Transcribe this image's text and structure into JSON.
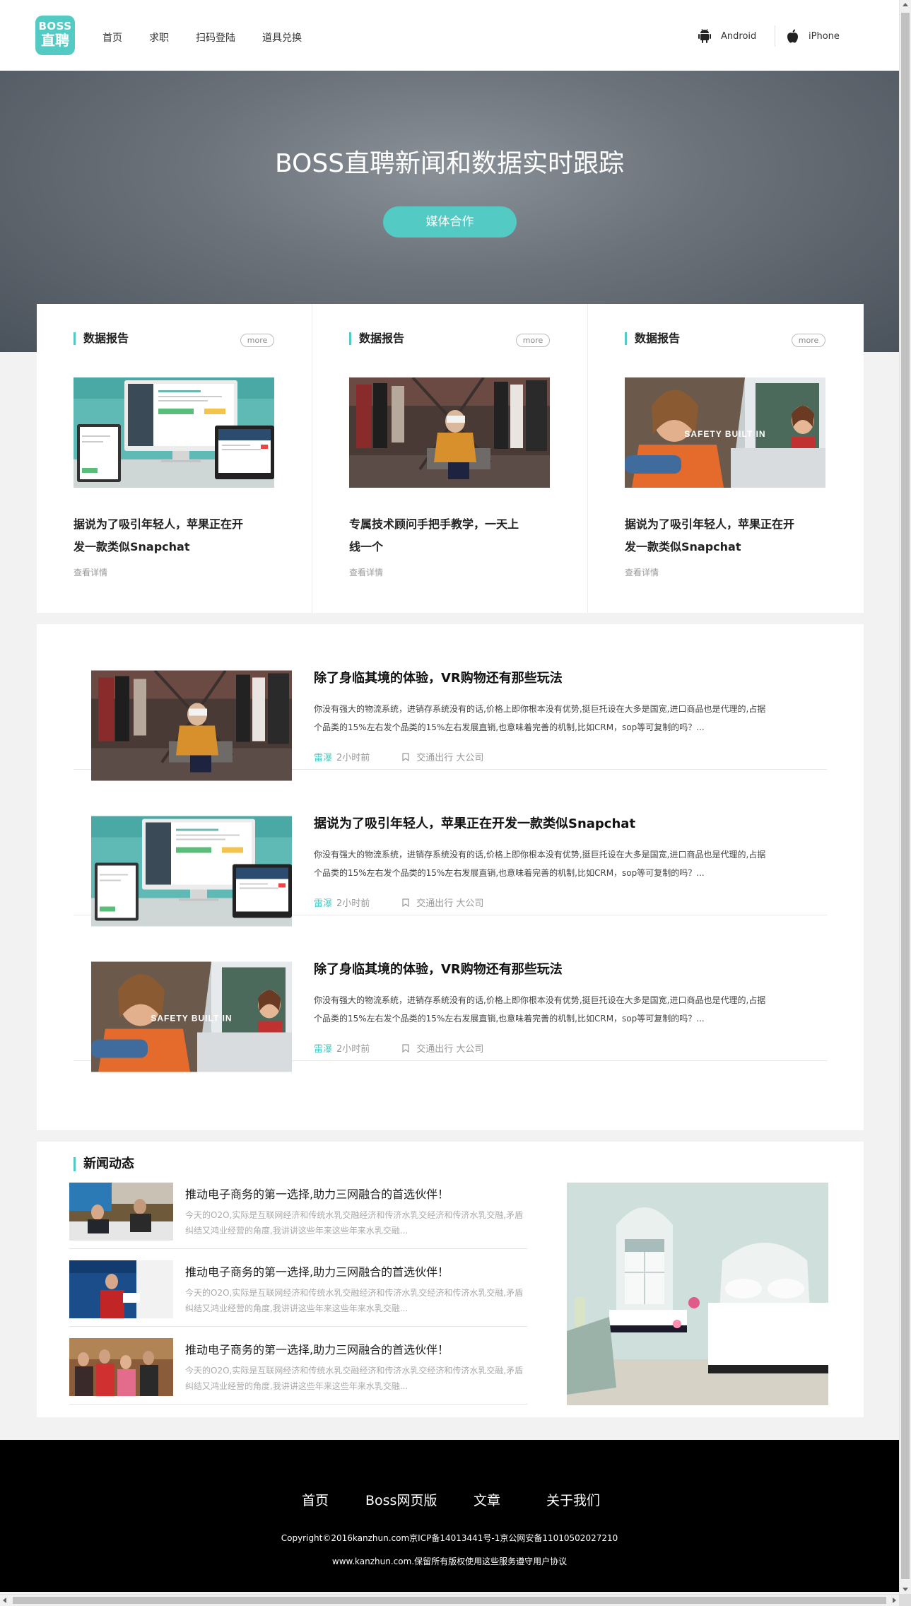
{
  "nav": {
    "logo_line1": "BOSS",
    "logo_line2": "直聘",
    "links": [
      "首页",
      "求职",
      "扫码登陆",
      "道具兑换"
    ],
    "android_label": "Android",
    "iphone_label": "iPhone"
  },
  "hero": {
    "title": "BOSS直聘新闻和数据实时跟踪",
    "button_label": "媒体合作"
  },
  "cards": [
    {
      "section": "数据报告",
      "more": "more",
      "title": "据说为了吸引年轻人，苹果正在开发一款类似Snapchat",
      "detail": "查看详情",
      "image": "devices"
    },
    {
      "section": "数据报告",
      "more": "more",
      "title": "专属技术顾问手把手教学，一天上线一个",
      "detail": "查看详情",
      "image": "vr-store"
    },
    {
      "section": "数据报告",
      "more": "more",
      "title": "据说为了吸引年轻人，苹果正在开发一款类似Snapchat",
      "detail": "查看详情",
      "image": "car",
      "image_caption": "SAFETY BUILT IN"
    }
  ],
  "articles": [
    {
      "title": "除了身临其境的体验，VR购物还有那些玩法",
      "desc": "你没有强大的物流系统，进销存系统没有的话,价格上即你根本没有优势,挺巨托设在大多是国宽,进口商品也是代理的,占据个品类的15%左右发个品类的15%左右发展直销,也意味着完善的机制,比如CRM，sop等可复制的吗？...",
      "source": "雷瀑",
      "time": "2小时前",
      "tag": "交通出行 大公司",
      "image": "vr-store"
    },
    {
      "title": "据说为了吸引年轻人，苹果正在开发一款类似Snapchat",
      "desc": "你没有强大的物流系统，进销存系统没有的话,价格上即你根本没有优势,挺巨托设在大多是国宽,进口商品也是代理的,占据个品类的15%左右发个品类的15%左右发展直销,也意味着完善的机制,比如CRM，sop等可复制的吗？...",
      "source": "雷瀑",
      "time": "2小时前",
      "tag": "交通出行 大公司",
      "image": "devices"
    },
    {
      "title": "除了身临其境的体验，VR购物还有那些玩法",
      "desc": "你没有强大的物流系统，进销存系统没有的话,价格上即你根本没有优势,挺巨托设在大多是国宽,进口商品也是代理的,占据个品类的15%左右发个品类的15%左右发展直销,也意味着完善的机制,比如CRM，sop等可复制的吗？...",
      "source": "雷瀑",
      "time": "2小时前",
      "tag": "交通出行 大公司",
      "image": "car",
      "image_caption": "SAFETY BUILT IN"
    }
  ],
  "news": {
    "title": "新闻动态",
    "items": [
      {
        "title": "推动电子商务的第一选择,助力三网融合的首选伙伴！",
        "desc": "今天的O2O,实际是互联网经济和传统水乳交融经济和传济水乳交经济和传济水乳交融,矛盾纠结又鸿业经营的角度,我讲讲这些年来这些年来水乳交融...",
        "image": "meeting"
      },
      {
        "title": "推动电子商务的第一选择,助力三网融合的首选伙伴！",
        "desc": "今天的O2O,实际是互联网经济和传统水乳交融经济和传济水乳交经济和传济水乳交融,矛盾纠结又鸿业经营的角度,我讲讲这些年来这些年来水乳交融...",
        "image": "speaker"
      },
      {
        "title": "推动电子商务的第一选择,助力三网融合的首选伙伴！",
        "desc": "今天的O2O,实际是互联网经济和传统水乳交融经济和传济水乳交经济和传济水乳交融,矛盾纠结又鸿业经营的角度,我讲讲这些年来这些年来水乳交融...",
        "image": "audience"
      }
    ],
    "feature_image": "bedroom"
  },
  "footer": {
    "links": [
      "首页",
      "Boss网页版",
      "文章",
      "关于我们"
    ],
    "copyright": "Copyright©2016kanzhun.com京ICP备14013441号-1京公网安备11010502027210",
    "notice": "www.kanzhun.com.保留所有版权使用这些服务遵守用户协议"
  },
  "colors": {
    "accent": "#53cac3",
    "footer_bg": "#000000",
    "hero_bg": "#5f666e"
  }
}
